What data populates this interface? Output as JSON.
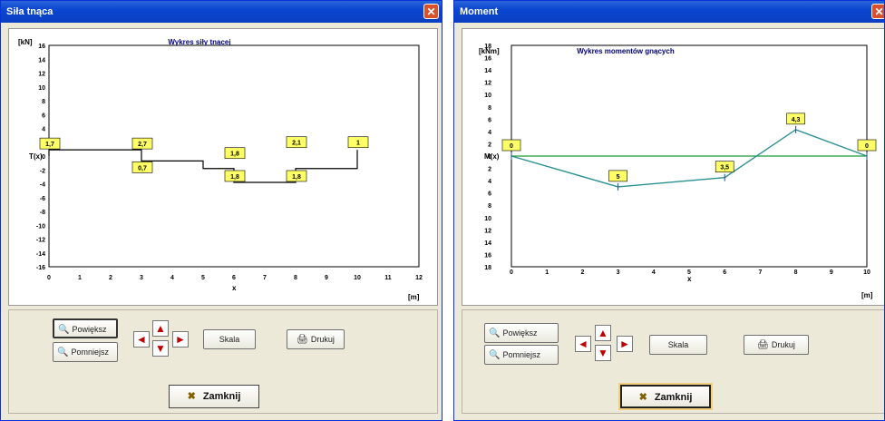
{
  "colors": {
    "titlebar": "#0a46d0",
    "shear_line": "#000000",
    "moment_line": "#2a9090",
    "zero_line": "#1e9a3c",
    "label_bg": "#ffff66"
  },
  "win1": {
    "title": "Siła tnąca",
    "close_glyph": "✕",
    "chart": {
      "title": "Wykres siły tnącej",
      "unit_y": "[kN]",
      "axis_label_y": "T(x)",
      "axis_label_x": "x",
      "unit_x": "[m]",
      "yticks": [
        "16",
        "14",
        "12",
        "10",
        "8",
        "6",
        "4",
        "2",
        "0",
        "-2",
        "-4",
        "-6",
        "-8",
        "-10",
        "-12",
        "-14",
        "-16"
      ],
      "xticks": [
        "0",
        "1",
        "2",
        "3",
        "4",
        "5",
        "6",
        "7",
        "8",
        "9",
        "10",
        "11",
        "12"
      ],
      "labels": [
        "1,7",
        "2,7",
        "0,7",
        "1,8",
        "1,8",
        "1,8",
        "2,1",
        "1"
      ]
    },
    "buttons": {
      "zoom_in": "Powiększ",
      "zoom_out": "Pomniejsz",
      "scale": "Skala",
      "print": "Drukuj",
      "close": "Zamknij"
    }
  },
  "win2": {
    "title": "Moment",
    "close_glyph": "✕",
    "chart": {
      "title": "Wykres momentów gnących",
      "unit_y": "[kNm]",
      "axis_label_y": "M(x)",
      "axis_label_x": "x",
      "unit_x": "[m]",
      "yticks": [
        "18",
        "16",
        "14",
        "12",
        "10",
        "8",
        "6",
        "4",
        "2",
        "0",
        "2",
        "4",
        "6",
        "8",
        "10",
        "12",
        "14",
        "16",
        "18"
      ],
      "xticks": [
        "0",
        "1",
        "2",
        "3",
        "4",
        "5",
        "6",
        "7",
        "8",
        "9",
        "10"
      ],
      "labels": [
        "0",
        "5",
        "3,5",
        "4,3",
        "0"
      ]
    },
    "buttons": {
      "zoom_in": "Powiększ",
      "zoom_out": "Pomniejsz",
      "scale": "Skala",
      "print": "Drukuj",
      "close": "Zamknij"
    }
  },
  "chart_data": [
    {
      "type": "line",
      "title": "Wykres siły tnącej",
      "xlabel": "x",
      "ylabel": "T(x)",
      "xlim": [
        0,
        12
      ],
      "ylim": [
        -16,
        16
      ],
      "series": [
        {
          "x": [
            0,
            0,
            3,
            3,
            5,
            5,
            6,
            6,
            8,
            8,
            10,
            10
          ],
          "values": [
            0,
            0.9,
            0.9,
            -0.7,
            -0.7,
            -1.8,
            -1.8,
            -3.8,
            -3.8,
            -1.8,
            -1.8,
            0.9
          ]
        }
      ]
    },
    {
      "type": "line",
      "title": "Wykres momentów gnących",
      "xlabel": "x",
      "ylabel": "M(x)",
      "xlim": [
        0,
        10
      ],
      "ylim": [
        -18,
        18
      ],
      "series": [
        {
          "x": [
            0,
            3,
            6,
            8,
            10
          ],
          "values": [
            0,
            -5,
            -3.5,
            4.3,
            0
          ]
        }
      ]
    }
  ]
}
